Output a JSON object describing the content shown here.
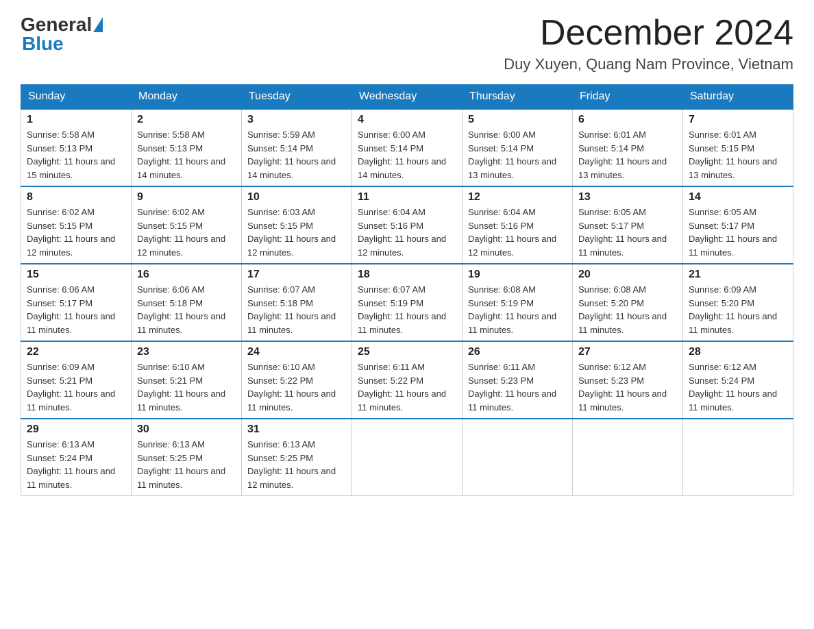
{
  "header": {
    "logo": {
      "general": "General",
      "blue": "Blue"
    },
    "title": "December 2024",
    "location": "Duy Xuyen, Quang Nam Province, Vietnam"
  },
  "days_of_week": [
    "Sunday",
    "Monday",
    "Tuesday",
    "Wednesday",
    "Thursday",
    "Friday",
    "Saturday"
  ],
  "weeks": [
    [
      {
        "day": "1",
        "sunrise": "5:58 AM",
        "sunset": "5:13 PM",
        "daylight": "11 hours and 15 minutes."
      },
      {
        "day": "2",
        "sunrise": "5:58 AM",
        "sunset": "5:13 PM",
        "daylight": "11 hours and 14 minutes."
      },
      {
        "day": "3",
        "sunrise": "5:59 AM",
        "sunset": "5:14 PM",
        "daylight": "11 hours and 14 minutes."
      },
      {
        "day": "4",
        "sunrise": "6:00 AM",
        "sunset": "5:14 PM",
        "daylight": "11 hours and 14 minutes."
      },
      {
        "day": "5",
        "sunrise": "6:00 AM",
        "sunset": "5:14 PM",
        "daylight": "11 hours and 13 minutes."
      },
      {
        "day": "6",
        "sunrise": "6:01 AM",
        "sunset": "5:14 PM",
        "daylight": "11 hours and 13 minutes."
      },
      {
        "day": "7",
        "sunrise": "6:01 AM",
        "sunset": "5:15 PM",
        "daylight": "11 hours and 13 minutes."
      }
    ],
    [
      {
        "day": "8",
        "sunrise": "6:02 AM",
        "sunset": "5:15 PM",
        "daylight": "11 hours and 12 minutes."
      },
      {
        "day": "9",
        "sunrise": "6:02 AM",
        "sunset": "5:15 PM",
        "daylight": "11 hours and 12 minutes."
      },
      {
        "day": "10",
        "sunrise": "6:03 AM",
        "sunset": "5:15 PM",
        "daylight": "11 hours and 12 minutes."
      },
      {
        "day": "11",
        "sunrise": "6:04 AM",
        "sunset": "5:16 PM",
        "daylight": "11 hours and 12 minutes."
      },
      {
        "day": "12",
        "sunrise": "6:04 AM",
        "sunset": "5:16 PM",
        "daylight": "11 hours and 12 minutes."
      },
      {
        "day": "13",
        "sunrise": "6:05 AM",
        "sunset": "5:17 PM",
        "daylight": "11 hours and 11 minutes."
      },
      {
        "day": "14",
        "sunrise": "6:05 AM",
        "sunset": "5:17 PM",
        "daylight": "11 hours and 11 minutes."
      }
    ],
    [
      {
        "day": "15",
        "sunrise": "6:06 AM",
        "sunset": "5:17 PM",
        "daylight": "11 hours and 11 minutes."
      },
      {
        "day": "16",
        "sunrise": "6:06 AM",
        "sunset": "5:18 PM",
        "daylight": "11 hours and 11 minutes."
      },
      {
        "day": "17",
        "sunrise": "6:07 AM",
        "sunset": "5:18 PM",
        "daylight": "11 hours and 11 minutes."
      },
      {
        "day": "18",
        "sunrise": "6:07 AM",
        "sunset": "5:19 PM",
        "daylight": "11 hours and 11 minutes."
      },
      {
        "day": "19",
        "sunrise": "6:08 AM",
        "sunset": "5:19 PM",
        "daylight": "11 hours and 11 minutes."
      },
      {
        "day": "20",
        "sunrise": "6:08 AM",
        "sunset": "5:20 PM",
        "daylight": "11 hours and 11 minutes."
      },
      {
        "day": "21",
        "sunrise": "6:09 AM",
        "sunset": "5:20 PM",
        "daylight": "11 hours and 11 minutes."
      }
    ],
    [
      {
        "day": "22",
        "sunrise": "6:09 AM",
        "sunset": "5:21 PM",
        "daylight": "11 hours and 11 minutes."
      },
      {
        "day": "23",
        "sunrise": "6:10 AM",
        "sunset": "5:21 PM",
        "daylight": "11 hours and 11 minutes."
      },
      {
        "day": "24",
        "sunrise": "6:10 AM",
        "sunset": "5:22 PM",
        "daylight": "11 hours and 11 minutes."
      },
      {
        "day": "25",
        "sunrise": "6:11 AM",
        "sunset": "5:22 PM",
        "daylight": "11 hours and 11 minutes."
      },
      {
        "day": "26",
        "sunrise": "6:11 AM",
        "sunset": "5:23 PM",
        "daylight": "11 hours and 11 minutes."
      },
      {
        "day": "27",
        "sunrise": "6:12 AM",
        "sunset": "5:23 PM",
        "daylight": "11 hours and 11 minutes."
      },
      {
        "day": "28",
        "sunrise": "6:12 AM",
        "sunset": "5:24 PM",
        "daylight": "11 hours and 11 minutes."
      }
    ],
    [
      {
        "day": "29",
        "sunrise": "6:13 AM",
        "sunset": "5:24 PM",
        "daylight": "11 hours and 11 minutes."
      },
      {
        "day": "30",
        "sunrise": "6:13 AM",
        "sunset": "5:25 PM",
        "daylight": "11 hours and 11 minutes."
      },
      {
        "day": "31",
        "sunrise": "6:13 AM",
        "sunset": "5:25 PM",
        "daylight": "11 hours and 12 minutes."
      },
      null,
      null,
      null,
      null
    ]
  ]
}
